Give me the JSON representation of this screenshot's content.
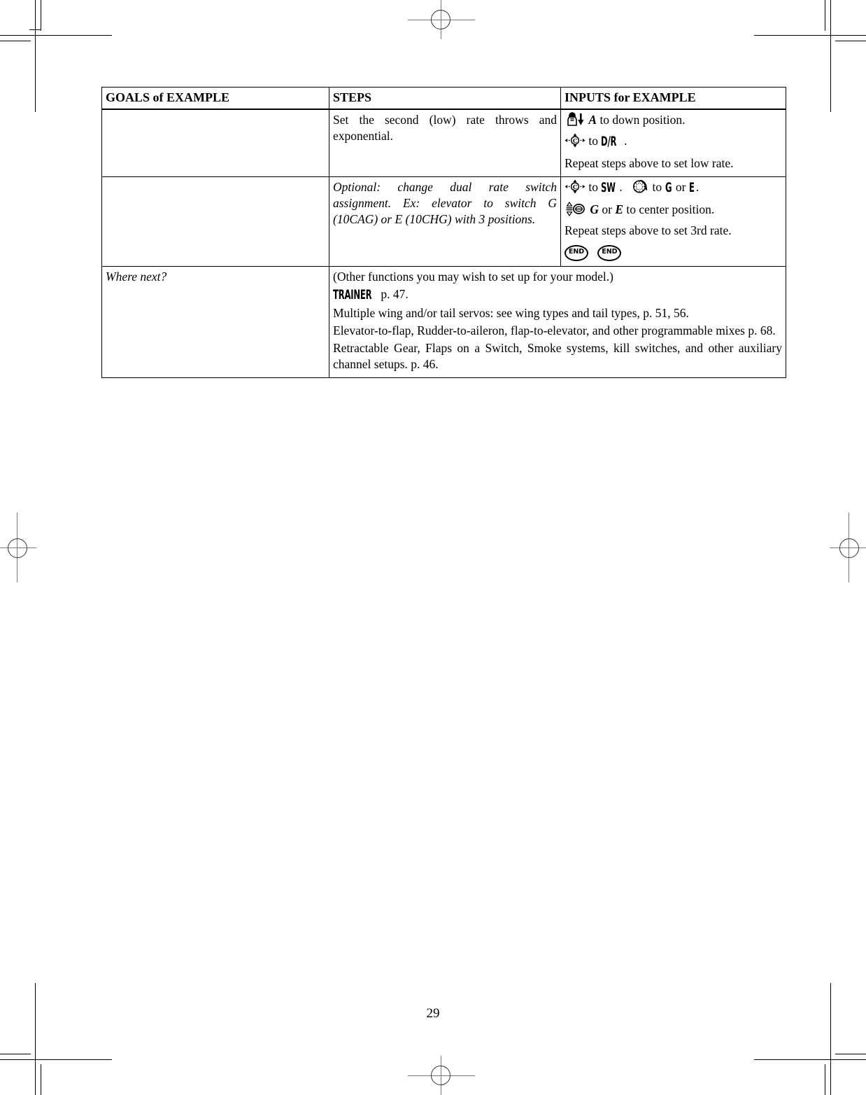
{
  "document": {
    "page_number": "29",
    "table": {
      "headers": {
        "goals": "GOALS of EXAMPLE",
        "steps": "STEPS",
        "inputs": "INPUTS for EXAMPLE"
      },
      "rows": [
        {
          "goals": "",
          "steps": "Set the second (low) rate throws and exponential.",
          "inputs": {
            "line1_icon": "toggle-switch-down-icon",
            "line1_a": "A",
            "line1_text": " to down position.",
            "line2_icon": "cursor-pad-icon",
            "line2_pre": "to",
            "line2_label": "D/R",
            "line2_post": ".",
            "line3_text": "Repeat steps above to set low rate."
          }
        },
        {
          "goals": "",
          "steps": "Optional: change dual rate switch assignment. Ex: elevator to switch G (10CAG) or E (10CHG) with 3 positions.",
          "inputs": {
            "line1_icon": "cursor-pad-icon",
            "line1_pre": "to",
            "line1_label": "SW",
            "line1_mid": ".",
            "line1_icon2": "rotary-dial-icon",
            "line1_pre2": "to",
            "line1_label_g": "G",
            "line1_or": "or",
            "line1_label_e": "E",
            "line1_end": ".",
            "line2_icon": "lever-updown-icon",
            "line2_g": "G",
            "line2_or": " or ",
            "line2_e": "E",
            "line2_text": " to center position.",
            "line3_text": "Repeat steps above to set 3rd rate.",
            "end_button_1": "END",
            "end_button_2": "END"
          }
        },
        {
          "goals": "Where next?",
          "steps_block": {
            "line1": "(Other functions you may wish to set up for your model.)",
            "line2_label": "TRAINER",
            "line2_rest": " p. 47.",
            "line3": "Multiple wing and/or tail servos: see wing types and tail types, p. 51, 56.",
            "line4": "Elevator-to-flap, Rudder-to-aileron, flap-to-elevator, and other programmable mixes p. 68.",
            "line5": "Retractable Gear, Flaps on a Switch, Smoke systems, kill switches, and other auxiliary channel setups. p. 46."
          }
        }
      ]
    }
  }
}
